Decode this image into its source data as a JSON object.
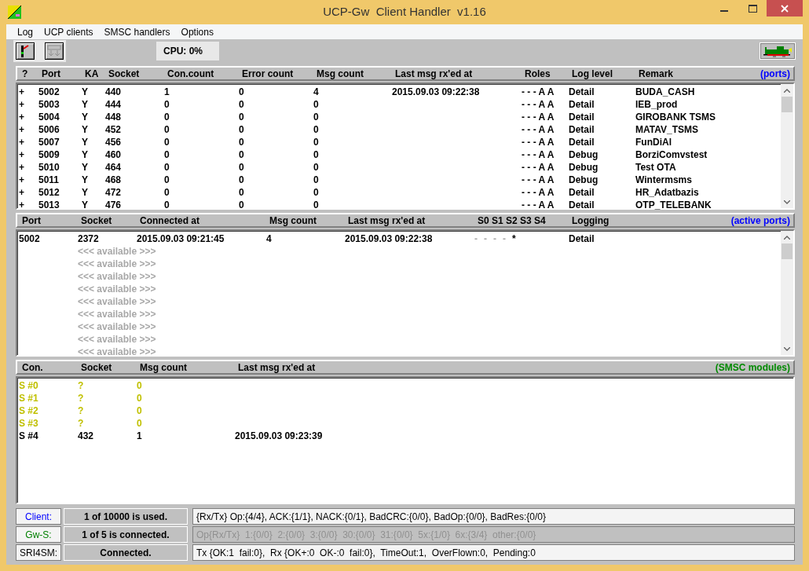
{
  "window": {
    "title": "UCP-Gw  Client Handler  v1.16"
  },
  "menu": [
    "Log",
    "UCP clients",
    "SMSC handlers",
    "Options"
  ],
  "toolbar": {
    "cpu": "CPU:  0%"
  },
  "ports": {
    "tag": "(ports)",
    "columns": [
      "?",
      "Port",
      "KA",
      "Socket",
      "Con.count",
      "Error count",
      "Msg count",
      "Last msg rx'ed at",
      "Roles",
      "Log level",
      "Remark"
    ],
    "rows": [
      [
        "+",
        "5002",
        "Y",
        "440",
        "1",
        "0",
        "4",
        "2015.09.03 09:22:38",
        "- - - A A",
        "Detail",
        "BUDA_CASH"
      ],
      [
        "+",
        "5003",
        "Y",
        "444",
        "0",
        "0",
        "0",
        "",
        "- - - A A",
        "Detail",
        "IEB_prod"
      ],
      [
        "+",
        "5004",
        "Y",
        "448",
        "0",
        "0",
        "0",
        "",
        "- - - A A",
        "Detail",
        "GIROBANK TSMS"
      ],
      [
        "+",
        "5006",
        "Y",
        "452",
        "0",
        "0",
        "0",
        "",
        "- - - A A",
        "Detail",
        "MATAV_TSMS"
      ],
      [
        "+",
        "5007",
        "Y",
        "456",
        "0",
        "0",
        "0",
        "",
        "- - - A A",
        "Detail",
        "FunDiAl"
      ],
      [
        "+",
        "5009",
        "Y",
        "460",
        "0",
        "0",
        "0",
        "",
        "- - - A A",
        "Debug",
        "BorziComvstest"
      ],
      [
        "+",
        "5010",
        "Y",
        "464",
        "0",
        "0",
        "0",
        "",
        "- - - A A",
        "Debug",
        "Test OTA"
      ],
      [
        "+",
        "5011",
        "Y",
        "468",
        "0",
        "0",
        "0",
        "",
        "- - - A A",
        "Debug",
        "Wintermsms"
      ],
      [
        "+",
        "5012",
        "Y",
        "472",
        "0",
        "0",
        "0",
        "",
        "- - - A A",
        "Detail",
        "HR_Adatbazis"
      ],
      [
        "+",
        "5013",
        "Y",
        "476",
        "0",
        "0",
        "0",
        "",
        "- - - A A",
        "Detail",
        "OTP_TELEBANK"
      ]
    ]
  },
  "active_ports": {
    "tag": "(active ports)",
    "columns": [
      "Port",
      "Socket",
      "Connected at",
      "Msg count",
      "Last msg rx'ed at",
      "S0 S1 S2 S3 S4",
      "Logging"
    ],
    "rows": [
      {
        "kind": "session",
        "cells": [
          "5002",
          "2372",
          "2015.09.03 09:21:45",
          "4",
          "2015.09.03 09:22:38"
        ],
        "flags": [
          {
            "text": "-",
            "active": false
          },
          {
            "text": "-",
            "active": false
          },
          {
            "text": "-",
            "active": false
          },
          {
            "text": "-",
            "active": false
          },
          {
            "text": "*",
            "active": true
          }
        ],
        "logging": "Detail"
      },
      {
        "kind": "available",
        "text": "<<< available >>>"
      },
      {
        "kind": "available",
        "text": "<<< available >>>"
      },
      {
        "kind": "available",
        "text": "<<< available >>>"
      },
      {
        "kind": "available",
        "text": "<<< available >>>"
      },
      {
        "kind": "available",
        "text": "<<< available >>>"
      },
      {
        "kind": "available",
        "text": "<<< available >>>"
      },
      {
        "kind": "available",
        "text": "<<< available >>>"
      },
      {
        "kind": "available",
        "text": "<<< available >>>"
      },
      {
        "kind": "available",
        "text": "<<< available >>>"
      }
    ]
  },
  "smsc": {
    "tag": "(SMSC modules)",
    "columns": [
      "Con.",
      "Socket",
      "Msg count",
      "Last msg rx'ed at"
    ],
    "rows": [
      {
        "connected": false,
        "cells": [
          "S #0",
          "?",
          "0",
          ""
        ]
      },
      {
        "connected": false,
        "cells": [
          "S #1",
          "?",
          "0",
          ""
        ]
      },
      {
        "connected": false,
        "cells": [
          "S #2",
          "?",
          "0",
          ""
        ]
      },
      {
        "connected": false,
        "cells": [
          "S #3",
          "?",
          "0",
          ""
        ]
      },
      {
        "connected": true,
        "cells": [
          "S #4",
          "432",
          "1",
          "2015.09.03 09:23:39"
        ]
      }
    ]
  },
  "status": [
    {
      "label": "Client:",
      "color": "#0000ff",
      "summary": "1 of 10000 is used.",
      "detail": "{Rx/Tx} Op:{4/4}, ACK:{1/1}, NACK:{0/1}, BadCRC:{0/0}, BadOp:{0/0}, BadRes:{0/0}",
      "disabled": false
    },
    {
      "label": "Gw-S:",
      "color": "#008000",
      "summary": "1 of 5 is connected.",
      "detail": "Op{Rx/Tx}  1:{0/0}  2:{0/0}  3:{0/0}  30:{0/0}  31:{0/0}  5x:{1/0}  6x:{3/4}  other:{0/0}",
      "disabled": true
    },
    {
      "label": "SRI4SM:",
      "color": "#000000",
      "summary": "Connected.",
      "detail": "Tx {OK:1  fail:0},  Rx {OK+:0  OK-:0  fail:0},  TimeOut:1,  OverFlown:0,  Pending:0",
      "disabled": false
    }
  ]
}
